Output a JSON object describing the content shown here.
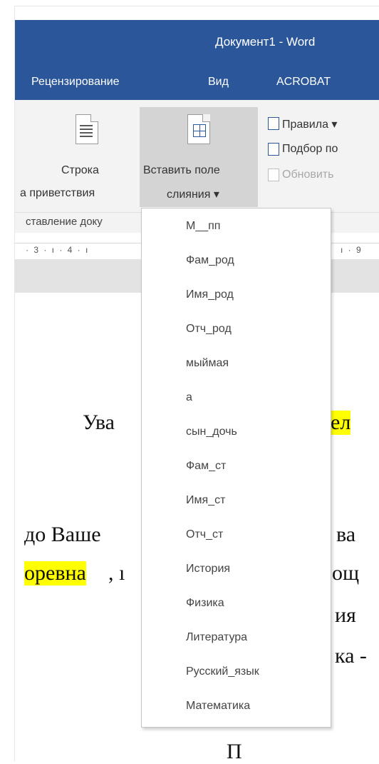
{
  "window": {
    "title": "Документ1 - Word"
  },
  "tabs": [
    "Рецензирование",
    "Вид",
    "ACROBAT"
  ],
  "ribbon": {
    "greeting_line": {
      "line1": "Строка",
      "line2": "а приветствия"
    },
    "insert_merge_field": {
      "line1": "Вставить поле",
      "line2": "слияния ▾"
    },
    "rules_label": "Правила ▾",
    "match_fields_label": "Подбор по",
    "update_labels_label": "Обновить",
    "group_label": "ставление доку"
  },
  "ruler": {
    "left": "· 3 · ı · 4 · ı",
    "right": "ı · 9"
  },
  "document": {
    "line1_a": "Ува",
    "line1_b": "ел",
    "line2_a": "до Ваше",
    "line2_b": "ва",
    "line3_a": "оревна",
    "line3_b": ", ı",
    "line3_c": "ощ",
    "line4": "ия",
    "line5": "ка -",
    "line6": "П"
  },
  "merge_fields_menu": {
    "items": [
      "М__пп",
      "Фам_род",
      "Имя_род",
      "Отч_род",
      "мыймая",
      "а",
      "сын_дочь",
      "Фам_ст",
      "Имя_ст",
      "Отч_ст",
      "История",
      "Физика",
      "Литература",
      "Русский_язык",
      "Математика"
    ]
  },
  "colors": {
    "accent": "#2b579a",
    "highlight": "#ffff00",
    "ribbon_bg": "#f3f3f3"
  }
}
